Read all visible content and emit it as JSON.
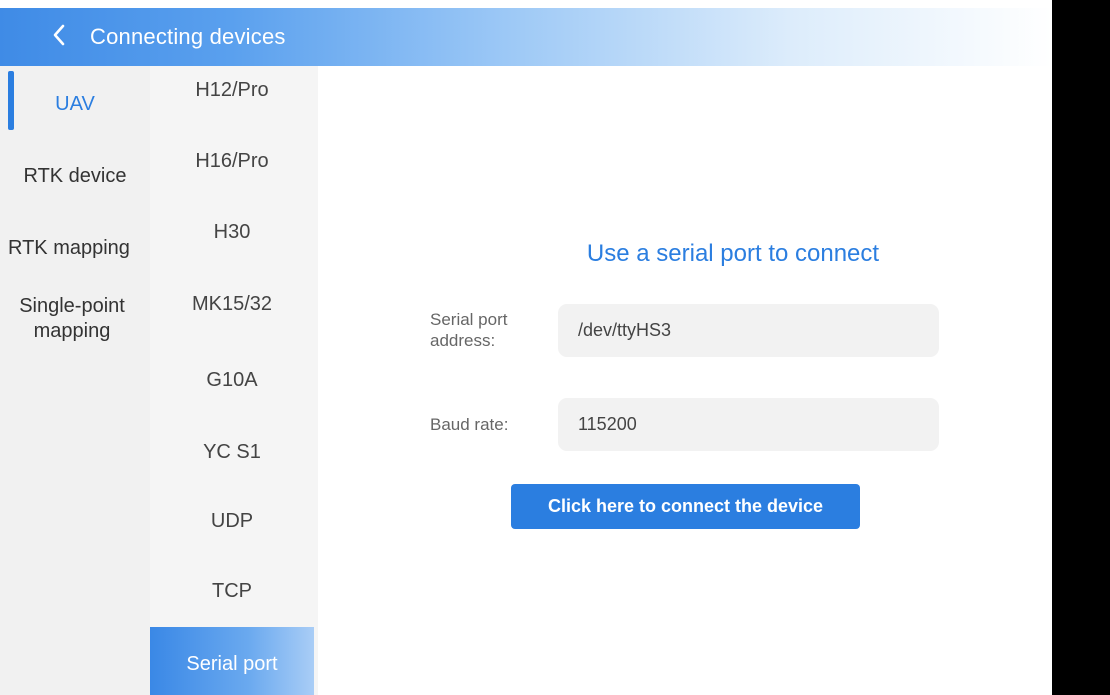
{
  "header": {
    "title": "Connecting devices",
    "back_icon": "chevron-left-icon"
  },
  "categories": [
    {
      "label": "UAV",
      "active": true
    },
    {
      "label": "RTK device",
      "active": false
    },
    {
      "label": "RTK mapping",
      "active": false
    },
    {
      "label": "Single-point mapping",
      "active": false
    }
  ],
  "models": [
    {
      "label": "H12/Pro",
      "active": false
    },
    {
      "label": "H16/Pro",
      "active": false
    },
    {
      "label": "H30",
      "active": false
    },
    {
      "label": "MK15/32",
      "active": false
    },
    {
      "label": "G10A",
      "active": false
    },
    {
      "label": "YC S1",
      "active": false
    },
    {
      "label": "UDP",
      "active": false
    },
    {
      "label": "TCP",
      "active": false
    },
    {
      "label": "Serial port",
      "active": true
    }
  ],
  "main": {
    "heading": "Use a serial port to connect",
    "serial_port": {
      "label": "Serial port address:",
      "value": "/dev/ttyHS3"
    },
    "baud_rate": {
      "label": "Baud rate:",
      "value": "115200"
    },
    "connect_label": "Click here to connect the device"
  },
  "colors": {
    "accent": "#2b7ee0",
    "header_start": "#3f8be6",
    "sidebar_bg": "#f1f1f1",
    "input_bg": "#f2f2f2"
  }
}
